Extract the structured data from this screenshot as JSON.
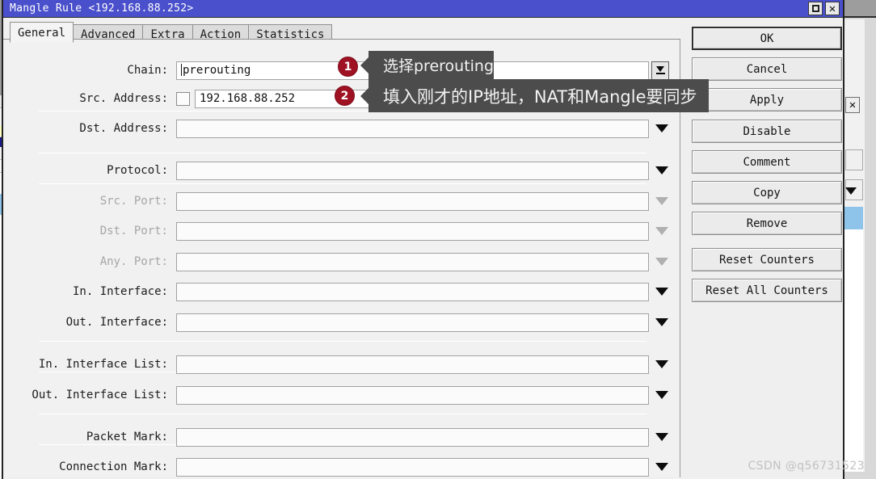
{
  "window": {
    "title": "Mangle Rule <192.168.88.252>",
    "maximize_icon": "maximize-icon",
    "close_icon": "close-icon"
  },
  "tabs": [
    {
      "label": "General",
      "active": true
    },
    {
      "label": "Advanced",
      "active": false
    },
    {
      "label": "Extra",
      "active": false
    },
    {
      "label": "Action",
      "active": false
    },
    {
      "label": "Statistics",
      "active": false
    }
  ],
  "form": {
    "fields": [
      {
        "label": "Chain:",
        "value": "prerouting",
        "type": "combo-edit",
        "disabled": false,
        "checkbox": false,
        "caret": true
      },
      {
        "label": "Src. Address:",
        "value": "192.168.88.252",
        "type": "text",
        "disabled": false,
        "checkbox": true,
        "caret": false
      },
      {
        "label": "Dst. Address:",
        "value": "",
        "type": "dropdown",
        "disabled": false,
        "checkbox": false,
        "caret": false
      },
      {
        "label": "Protocol:",
        "value": "",
        "type": "dropdown",
        "disabled": false,
        "checkbox": false,
        "caret": false
      },
      {
        "label": "Src. Port:",
        "value": "",
        "type": "dropdown",
        "disabled": true,
        "checkbox": false,
        "caret": false
      },
      {
        "label": "Dst. Port:",
        "value": "",
        "type": "dropdown",
        "disabled": true,
        "checkbox": false,
        "caret": false
      },
      {
        "label": "Any. Port:",
        "value": "",
        "type": "dropdown",
        "disabled": true,
        "checkbox": false,
        "caret": false
      },
      {
        "label": "In. Interface:",
        "value": "",
        "type": "dropdown",
        "disabled": false,
        "checkbox": false,
        "caret": false
      },
      {
        "label": "Out. Interface:",
        "value": "",
        "type": "dropdown",
        "disabled": false,
        "checkbox": false,
        "caret": false
      },
      {
        "label": "In. Interface List:",
        "value": "",
        "type": "dropdown",
        "disabled": false,
        "checkbox": false,
        "caret": false
      },
      {
        "label": "Out. Interface List:",
        "value": "",
        "type": "dropdown",
        "disabled": false,
        "checkbox": false,
        "caret": false
      },
      {
        "label": "Packet Mark:",
        "value": "",
        "type": "dropdown",
        "disabled": false,
        "checkbox": false,
        "caret": false
      },
      {
        "label": "Connection Mark:",
        "value": "",
        "type": "dropdown",
        "disabled": false,
        "checkbox": false,
        "caret": false
      }
    ]
  },
  "buttons": [
    {
      "label": "OK",
      "default": true
    },
    {
      "label": "Cancel",
      "default": false
    },
    {
      "label": "Apply",
      "default": false
    },
    {
      "label": "Disable",
      "default": false
    },
    {
      "label": "Comment",
      "default": false
    },
    {
      "label": "Copy",
      "default": false
    },
    {
      "label": "Remove",
      "default": false
    },
    {
      "label": "Reset Counters",
      "default": false
    },
    {
      "label": "Reset All Counters",
      "default": false
    }
  ],
  "annotations": [
    {
      "number": "1",
      "text": "选择prerouting"
    },
    {
      "number": "2",
      "text": "填入刚才的IP地址，NAT和Mangle要同步"
    }
  ],
  "watermark": "CSDN @q56731523",
  "colors": {
    "titlebar": "#4a50cb",
    "dialog_bg": "#f0f0f0",
    "badge": "#9e1223",
    "callout_bg": "#4c4c4c",
    "disabled_label": "#a6a6a6"
  }
}
